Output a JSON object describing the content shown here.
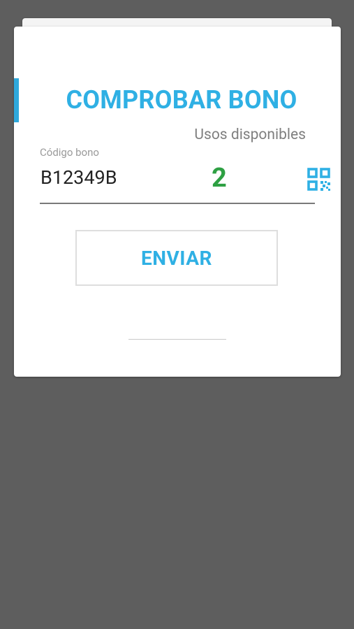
{
  "dialog": {
    "title": "COMPROBAR BONO",
    "usos_label": "Usos disponibles",
    "usos_count": "2",
    "code_label": "Código bono",
    "code_value": "B12349B",
    "send_label": "ENVIAR"
  },
  "icons": {
    "qr": "qr-code-icon"
  },
  "colors": {
    "accent": "#2fb0e4",
    "count": "#2ea043",
    "backdrop": "#5e5e5e"
  }
}
